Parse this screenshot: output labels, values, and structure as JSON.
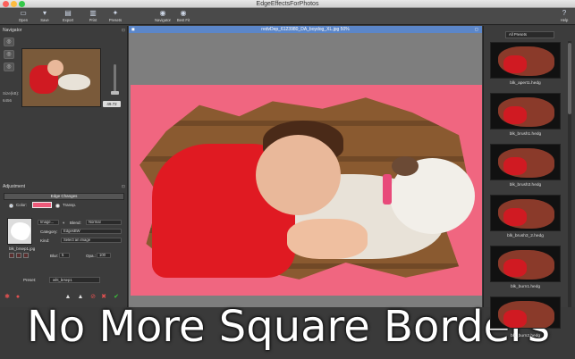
{
  "window": {
    "title": "EdgeEffectsForPhotos"
  },
  "toolbar": {
    "open": "Open",
    "save": "Save",
    "export": "Export",
    "print": "Print",
    "presets": "Presets",
    "navigator": "Navigator",
    "best_fit": "Best Fit",
    "help": "Help"
  },
  "navigator": {
    "title": "Navigator",
    "size_label": "Size(kB):",
    "size_value": "6456",
    "zoom_value": "49.72"
  },
  "adjustment": {
    "title": "Adjustment",
    "edge_changes": "Edge Changes",
    "color_label": "Color:",
    "transp_label": "Transp.",
    "image_select": "Image...",
    "blend_label": "Blend:",
    "blend_value": "Normal",
    "category_label": "Category:",
    "category_value": "EdgesBW",
    "kind_label": "Kind:",
    "kind_value": "Select an image",
    "file_label": "blk_brsep1.jpg",
    "blur_label": "Blur:",
    "blur_value": "5",
    "opa_label": "Opa.:",
    "opa_value": "100",
    "preset_label": "Preset:",
    "preset_value": "wht_brsep1"
  },
  "document": {
    "title": "redvDep_6123980_DA_boydog_XL.jpg 50%"
  },
  "banner": {
    "text": "No More Square Borders"
  },
  "presets_panel": {
    "filter": "All Presets",
    "items": [
      {
        "label": "blk_apert1.hedg"
      },
      {
        "label": "blk_brush1.hedg"
      },
      {
        "label": "blk_brush3.hedg"
      },
      {
        "label": "blk_brush3_2.hedg"
      },
      {
        "label": "blk_burn1.hedg"
      },
      {
        "label": "blk_burn2.hedg"
      }
    ]
  },
  "colors": {
    "accent": "#5b86c9",
    "swatch": "#ee5a7a",
    "photo_bg": "#f06680"
  }
}
